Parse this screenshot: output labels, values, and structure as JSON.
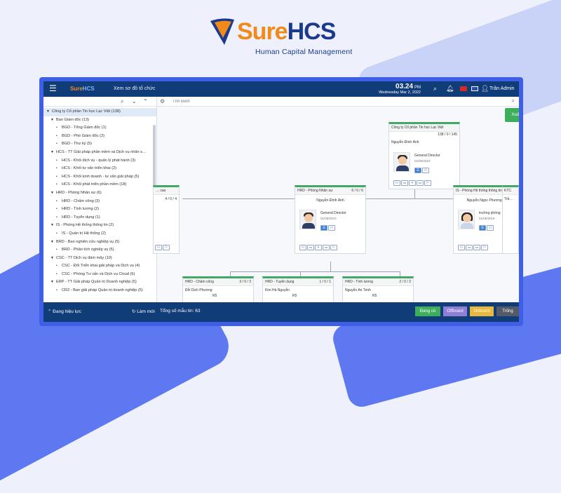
{
  "brand": {
    "name_part1": "Sure",
    "name_part2": "HCS",
    "tagline": "Human Capital Management"
  },
  "topbar": {
    "app_logo_part1": "Sure",
    "app_logo_part2": "HCS",
    "screen_title": "Xem sơ đồ tổ chức",
    "time": "03.24",
    "time_suffix": "PM",
    "date": "Wednesday Mar 2, 2022",
    "user": "Trần Admin"
  },
  "sidebar": {
    "tree": [
      {
        "label": "Công ty Cổ phần Tin học Lạc Việt (138)",
        "level": 0,
        "toggle": "▼"
      },
      {
        "label": "Ban Giám đốc (13)",
        "level": 1,
        "toggle": "▼"
      },
      {
        "label": "BGD - Tổng Giám đốc (1)",
        "level": 2,
        "toggle": "•"
      },
      {
        "label": "BGD - Phó Giám đốc (3)",
        "level": 2,
        "toggle": "•"
      },
      {
        "label": "BGD - Thư ký (5)",
        "level": 2,
        "toggle": "•"
      },
      {
        "label": "HCS - TT Giải pháp phần mềm và Dịch vụ nhân s…",
        "level": 1,
        "toggle": "▼"
      },
      {
        "label": "HCS - Khối dịch vụ - quản lý phát hành (3)",
        "level": 2,
        "toggle": "•"
      },
      {
        "label": "HCS - Khối tư vấn triển khai (2)",
        "level": 2,
        "toggle": "•"
      },
      {
        "label": "HCS - Khối kinh doanh - tư vấn giải pháp (5)",
        "level": 2,
        "toggle": "•"
      },
      {
        "label": "HCS - Khối phát triển phần mềm (18)",
        "level": 2,
        "toggle": "•"
      },
      {
        "label": "HRD - Phòng Nhân sự (6)",
        "level": 1,
        "toggle": "▼"
      },
      {
        "label": "HRD - Chấm công (3)",
        "level": 2,
        "toggle": "•"
      },
      {
        "label": "HRD - Tính lương (2)",
        "level": 2,
        "toggle": "•"
      },
      {
        "label": "HRD - Tuyển dụng (1)",
        "level": 2,
        "toggle": "•"
      },
      {
        "label": "IS - Phòng Hệ thống thông tin (2)",
        "level": 1,
        "toggle": "▼"
      },
      {
        "label": "IS - Quản trị Hệ thống (2)",
        "level": 2,
        "toggle": "•"
      },
      {
        "label": "BRD - Ban nghiên cứu nghiệp vụ (5)",
        "level": 1,
        "toggle": "▼"
      },
      {
        "label": "BRD - Phân tích nghiệp vụ (5)",
        "level": 2,
        "toggle": "•"
      },
      {
        "label": "CSC - TT Dịch vụ đám mây (10)",
        "level": 1,
        "toggle": "▼"
      },
      {
        "label": "CSC - Đối Triển khai giải pháp và Dịch vụ (4)",
        "level": 2,
        "toggle": "•"
      },
      {
        "label": "CSC - Phòng Tư vấn và Dịch vụ Cloud (6)",
        "level": 2,
        "toggle": "•"
      },
      {
        "label": "ERP - TT Giải pháp Quản trị Doanh nghiệp (5)",
        "level": 1,
        "toggle": "▼"
      },
      {
        "label": "CR2 - Ban giải pháp Quản trị doanh nghiệp (5)",
        "level": 2,
        "toggle": "•"
      }
    ]
  },
  "search": {
    "placeholder": "Tìm kiếm"
  },
  "export_label": "Xuất DL",
  "cards": {
    "root": {
      "title": "Công ty Cổ phần Tin học Lạc Việt",
      "count": "138 / 0 / 145",
      "person": "Nguyễn Đình Ánh",
      "role": "General Director",
      "date": "01/05/2010"
    },
    "left": {
      "title": "… cao",
      "count": "4 / 0 / 4"
    },
    "hrd": {
      "title": "HRD - Phòng Nhân sự",
      "count": "6 / 0 / 6",
      "person": "Nguyễn Đình Ánh",
      "role": "General Director",
      "date": "01/05/2010"
    },
    "is": {
      "title": "IS - Phòng Hệ thống thông tin",
      "count": "2 / 0 / 2",
      "person": "Nguyễn Ngọc Phương Thảo",
      "role": "trưởng phòng",
      "date": "01/05/2019"
    },
    "ktc": {
      "title": "KTC",
      "person": "Trầ…"
    },
    "hrd_cc": {
      "title": "HRD - Chấm công",
      "count": "3 / 0 / 3",
      "person": "Đỗi Dịch Phương",
      "code": "R5"
    },
    "hrd_td": {
      "title": "HRD - Tuyển dụng",
      "count": "1 / 0 / 1",
      "person": "Kim Hà Nguyễn",
      "code": "R5"
    },
    "hrd_tl": {
      "title": "HRD - Tính lương",
      "count": "2 / 0 / 2",
      "person": "Nguyễn An Trinh",
      "code": "R5"
    }
  },
  "footer": {
    "status_label": "Đang hiệu lực",
    "reload_label": "Làm mới",
    "total_label": "Tổng số mẫu tin:",
    "total_value": "63",
    "btn_active": "Đang có",
    "btn_offboard": "Offboard",
    "btn_onboard": "Onboard",
    "btn_empty": "Trống"
  },
  "colors": {
    "frame": "#3f5fe6",
    "topbar": "#103c77",
    "card_accent": "#42a866",
    "export": "#3fae5c"
  }
}
